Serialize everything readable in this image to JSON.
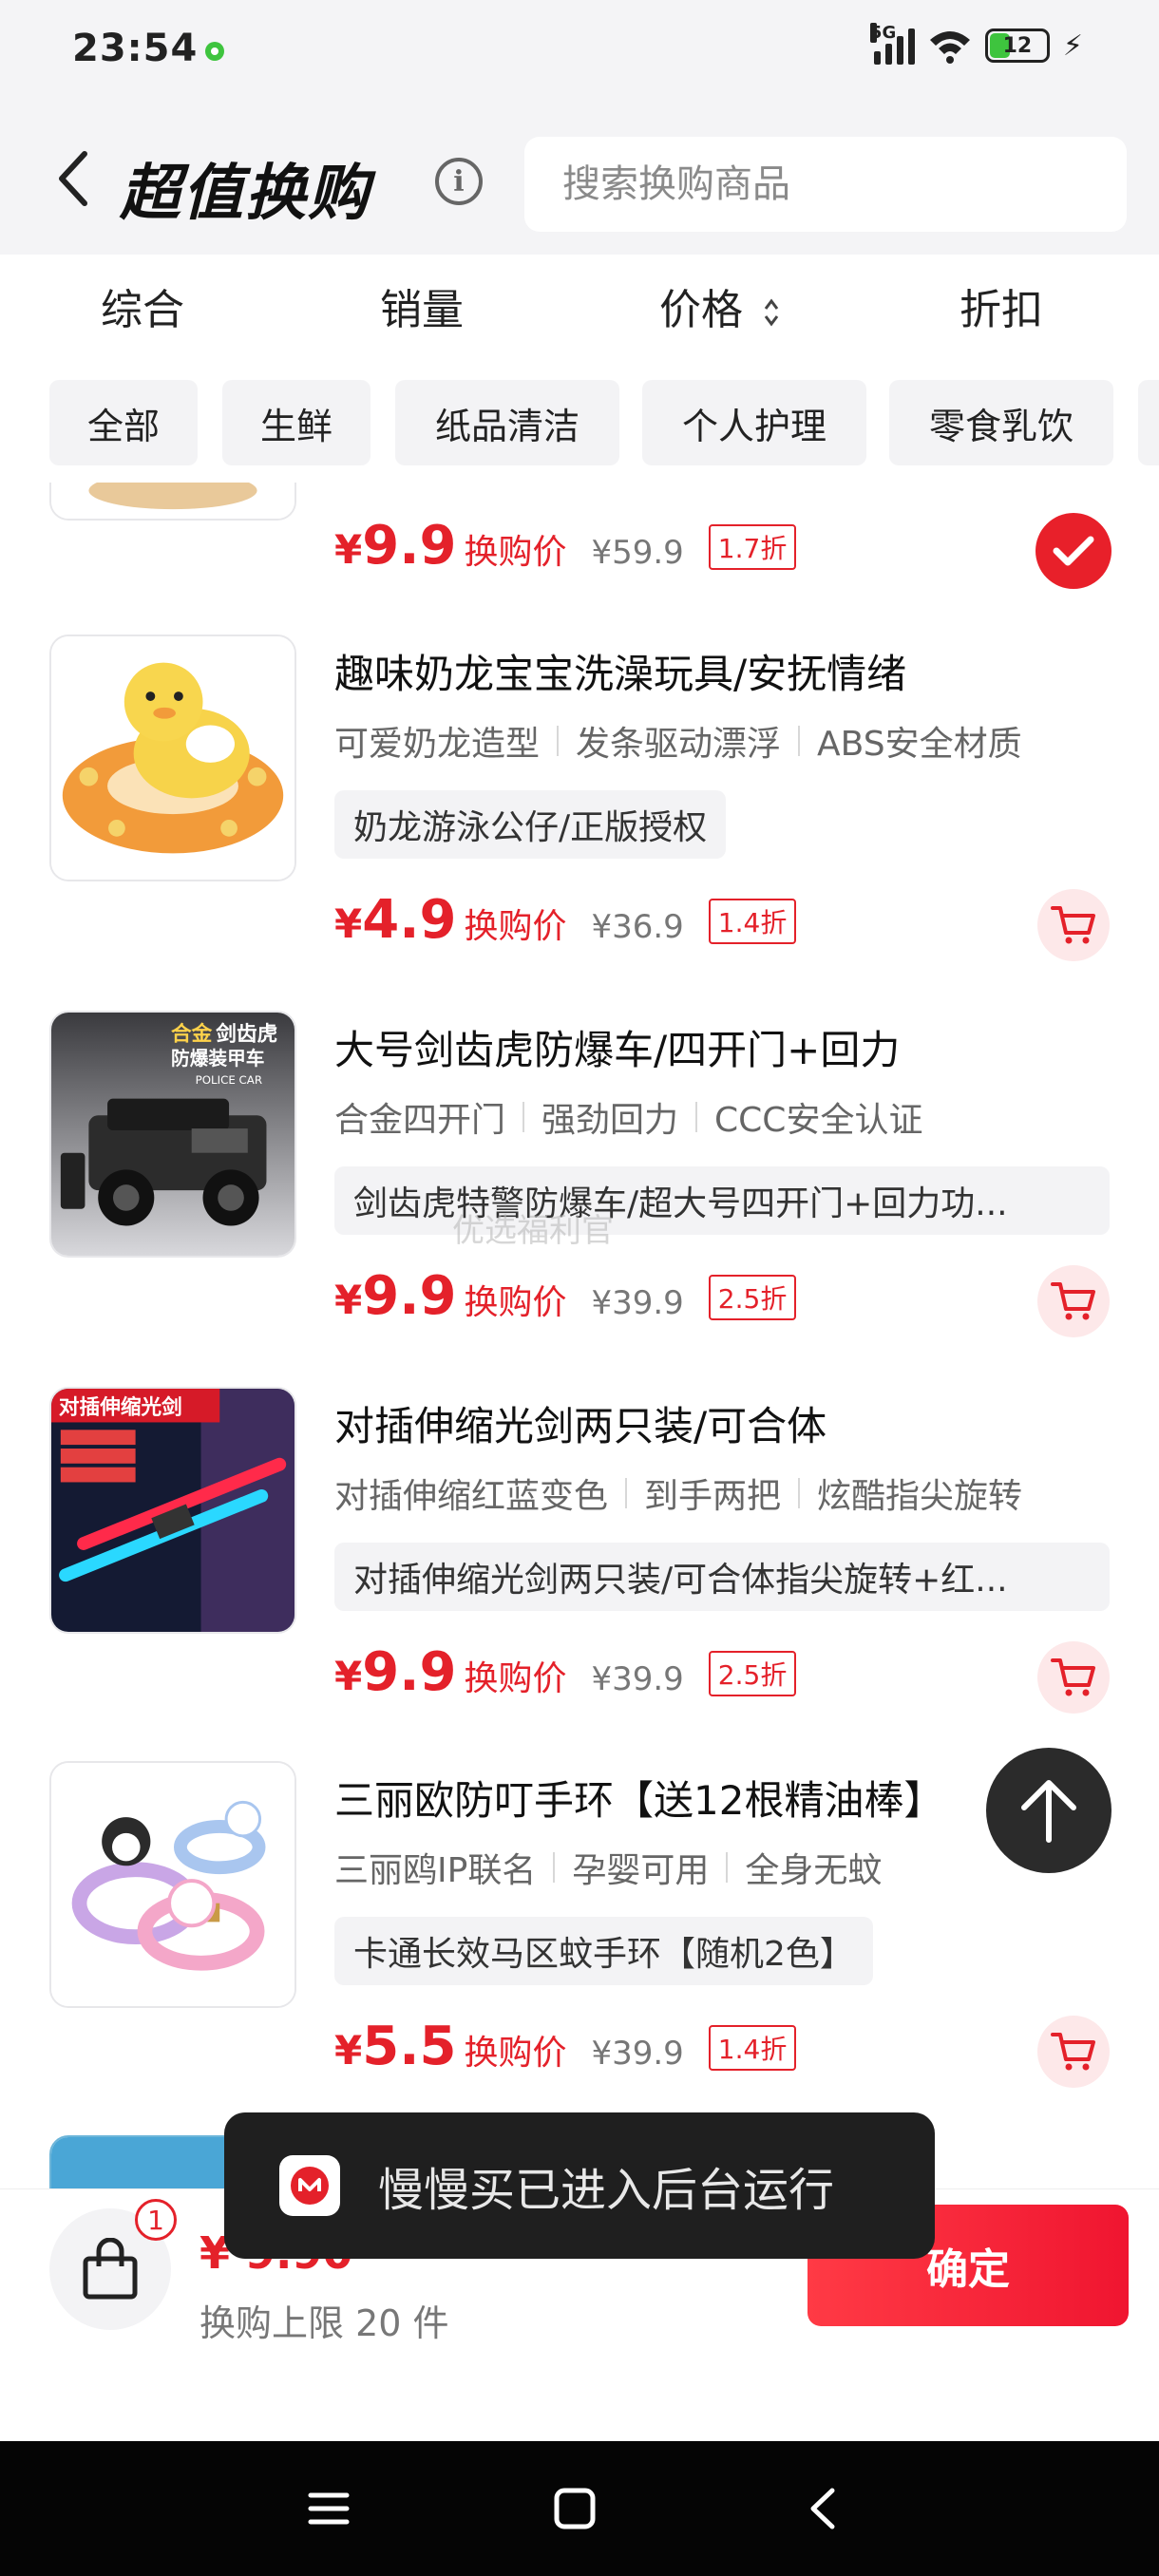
{
  "status_bar": {
    "time": "23:54",
    "network": "5G",
    "battery": "12"
  },
  "header": {
    "title": "超值换购",
    "search_placeholder": "搜索换购商品"
  },
  "sort_tabs": [
    "综合",
    "销量",
    "价格",
    "折扣"
  ],
  "category_chips": [
    "全部",
    "生鲜",
    "纸品清洁",
    "个人护理",
    "零食乳饮"
  ],
  "products": [
    {
      "price": "9.9",
      "price_label": "换购价",
      "original_price": "¥59.9",
      "discount": "1.7折",
      "selected": true
    },
    {
      "title": "趣味奶龙宝宝洗澡玩具/安抚情绪",
      "tags": [
        "可爱奶龙造型",
        "发条驱动漂浮",
        "ABS安全材质"
      ],
      "detail": "奶龙游泳公仔/正版授权",
      "price": "4.9",
      "price_label": "换购价",
      "original_price": "¥36.9",
      "discount": "1.4折"
    },
    {
      "title": "大号剑齿虎防爆车/四开门+回力",
      "tags": [
        "合金四开门",
        "强劲回力",
        "CCC安全认证"
      ],
      "detail": "剑齿虎特警防爆车/超大号四开门+回力功...",
      "price": "9.9",
      "price_label": "换购价",
      "original_price": "¥39.9",
      "discount": "2.5折"
    },
    {
      "title": "对插伸缩光剑两只装/可合体",
      "tags": [
        "对插伸缩红蓝变色",
        "到手两把",
        "炫酷指尖旋转"
      ],
      "detail": "对插伸缩光剑两只装/可合体指尖旋转+红...",
      "price": "9.9",
      "price_label": "换购价",
      "original_price": "¥39.9",
      "discount": "2.5折"
    },
    {
      "title": "三丽欧防叮手环【送12根精油棒】",
      "tags": [
        "三丽鸥IP联名",
        "孕婴可用",
        "全身无蚊"
      ],
      "detail": "卡通长效马区蚊手环【随机2色】",
      "price": "5.5",
      "price_label": "换购价",
      "original_price": "¥39.9",
      "discount": "1.4折"
    }
  ],
  "thumb_text": {
    "p3_line1": "合金",
    "p3_line1b": "剑齿虎",
    "p3_line2": "防爆装甲车",
    "p3_line3": "POLICE CAR",
    "p4_line1": "对插伸缩光剑"
  },
  "watermark": "优选福利官",
  "bottom_bar": {
    "badge": "1",
    "total": "¥ 9.90",
    "limit": "换购上限 20 件",
    "confirm": "确定"
  },
  "toast": {
    "text": "慢慢买已进入后台运行"
  },
  "colors": {
    "accent": "#e4212a",
    "background": "#f4f4f6"
  }
}
